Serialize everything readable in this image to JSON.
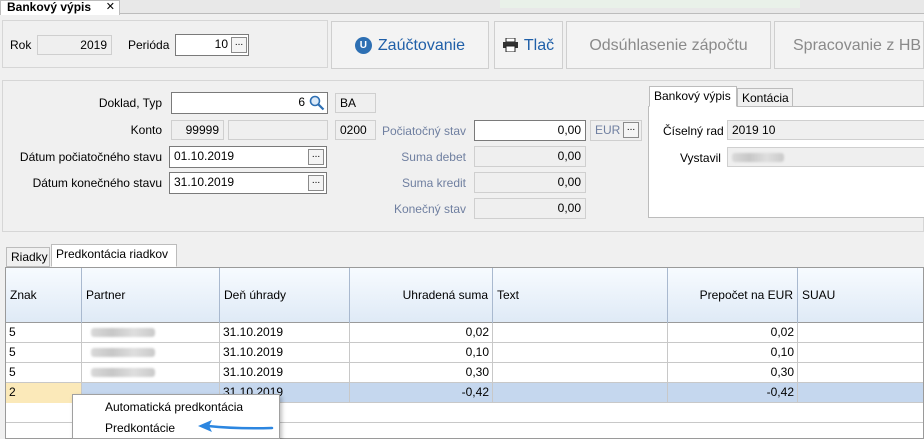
{
  "window": {
    "tab_title": "Bankový výpis",
    "close_glyph": "✕"
  },
  "toolbar": {
    "rok_label": "Rok",
    "rok_value": "2019",
    "perioda_label": "Perióda",
    "perioda_value": "10",
    "btn_zauctovanie": "Zaúčtovanie",
    "btn_zauctovanie_icon": "U",
    "btn_tlac": "Tlač",
    "btn_odsuhlasenie": "Odsúhlasenie zápočtu",
    "btn_spracovanie": "Spracovanie z HB"
  },
  "form": {
    "doklad_label": "Doklad, Typ",
    "doklad_value": "6",
    "typ_value": "BA",
    "konto_label": "Konto",
    "konto_value": "99999",
    "konto_code": "0200",
    "datum_poc_label": "Dátum počiatočného stavu",
    "datum_poc_value": "01.10.2019",
    "datum_kon_label": "Dátum konečného stavu",
    "datum_kon_value": "31.10.2019",
    "poc_stav_label": "Počiatočný stav",
    "poc_stav_value": "0,00",
    "currency": "EUR",
    "suma_debet_label": "Suma debet",
    "suma_debet_value": "0,00",
    "suma_kredit_label": "Suma kredit",
    "suma_kredit_value": "0,00",
    "konecny_stav_label": "Konečný stav",
    "konecny_stav_value": "0,00"
  },
  "right_panel": {
    "tabs": [
      "Bankový výpis",
      "Kontácia"
    ],
    "ciselny_rad_label": "Číselný rad",
    "ciselny_rad_value": "2019  10",
    "vystavil_label": "Vystavil"
  },
  "lower_tabs": [
    "Riadky",
    "Predkontácia riadkov"
  ],
  "table": {
    "headers": [
      "Znak",
      "Partner",
      "Deň úhrady",
      "Uhradená suma",
      "Text",
      "Prepočet na EUR",
      "SUAU"
    ],
    "rows": [
      {
        "znak": "5",
        "den": "31.10.2019",
        "suma": "0,02",
        "text": "",
        "prepocet": "0,02"
      },
      {
        "znak": "5",
        "den": "31.10.2019",
        "suma": "0,10",
        "text": "",
        "prepocet": "0,10"
      },
      {
        "znak": "5",
        "den": "31.10.2019",
        "suma": "0,30",
        "text": "",
        "prepocet": "0,30"
      },
      {
        "znak": "2",
        "den": "31.10.2019",
        "suma": "-0,42",
        "text": "",
        "prepocet": "-0,42"
      }
    ]
  },
  "context_menu": {
    "items": [
      "Automatická predkontácia",
      "Predkontácie"
    ]
  },
  "colors": {
    "accent": "#1f5fa8",
    "selection": "#c5d7ee",
    "edit_cell": "#fbe9b9",
    "arrow": "#2c86e0"
  },
  "icons": {
    "search": "magnifier-icon",
    "print": "printer-icon",
    "ellipsis": "..."
  }
}
